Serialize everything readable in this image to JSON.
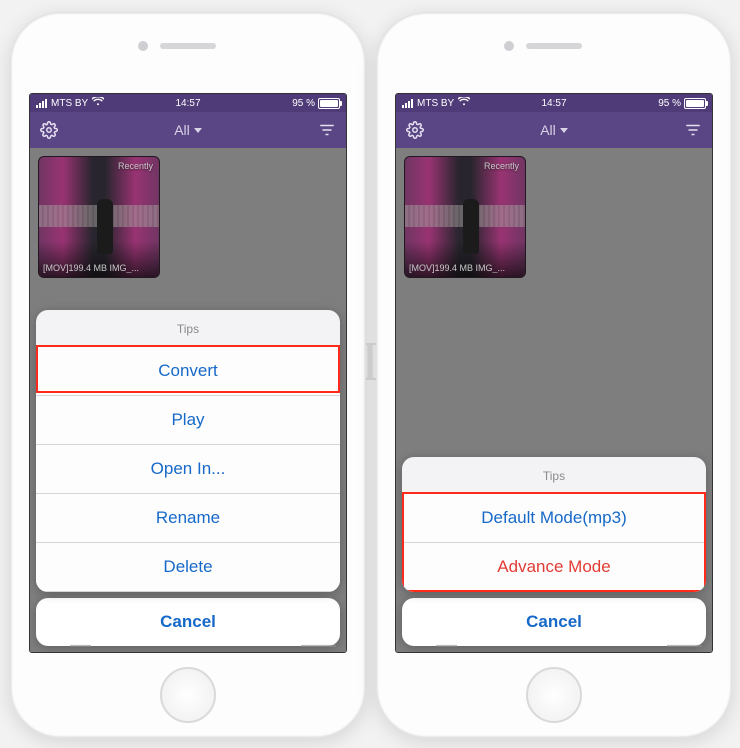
{
  "status": {
    "carrier": "MTS BY",
    "time": "14:57",
    "battery_pct": "95 %"
  },
  "nav": {
    "title": "All"
  },
  "video": {
    "tag": "Recently",
    "label": "[MOV]199.4 MB IMG_..."
  },
  "sheet_left": {
    "header": "Tips",
    "items": [
      {
        "label": "Convert",
        "danger": false
      },
      {
        "label": "Play",
        "danger": false
      },
      {
        "label": "Open In...",
        "danger": false
      },
      {
        "label": "Rename",
        "danger": false
      },
      {
        "label": "Delete",
        "danger": false
      }
    ],
    "cancel": "Cancel"
  },
  "sheet_right": {
    "header": "Tips",
    "items": [
      {
        "label": "Default Mode(mp3)",
        "danger": false
      },
      {
        "label": "Advance Mode",
        "danger": true
      }
    ],
    "cancel": "Cancel"
  },
  "watermark": "ЯБЛЫК"
}
